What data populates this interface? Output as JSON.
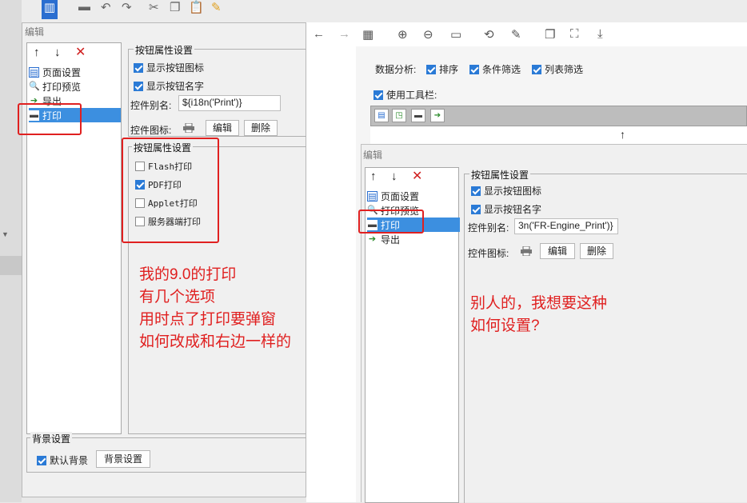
{
  "left_dialog": {
    "title": "编辑",
    "tree_items": [
      {
        "label": "页面设置",
        "icon": "page-setup-icon"
      },
      {
        "label": "打印预览",
        "icon": "print-preview-icon"
      },
      {
        "label": "导出",
        "icon": "export-icon"
      },
      {
        "label": "打印",
        "icon": "printer-icon",
        "selected": true
      }
    ],
    "button_props_legend": "按钮属性设置",
    "show_icon_label": "显示按钮图标",
    "show_name_label": "显示按钮名字",
    "alias_label": "控件别名:",
    "alias_value": "${i18n('Print')}",
    "icon_label": "控件图标:",
    "edit_button": "编辑",
    "delete_button": "删除",
    "print_options_legend": "按钮属性设置",
    "print_options": [
      {
        "label": "Flash打印",
        "checked": false
      },
      {
        "label": "PDF打印",
        "checked": true
      },
      {
        "label": "Applet打印",
        "checked": false
      },
      {
        "label": "服务器端打印",
        "checked": false
      }
    ],
    "bg_legend": "背景设置",
    "default_bg_label": "默认背景",
    "bg_settings_button": "背景设置"
  },
  "left_note": [
    "我的9.0的打印",
    "有几个选项",
    "用时点了打印要弹窗",
    "如何改成和右边一样的"
  ],
  "right_window": {
    "data_analysis_label": "数据分析:",
    "sort_label": "排序",
    "cond_filter_label": "条件筛选",
    "col_filter_label": "列表筛选",
    "use_toolbar_label": "使用工具栏:",
    "dialog_title": "编辑",
    "tree_items": [
      {
        "label": "页面设置",
        "icon": "page-setup-icon"
      },
      {
        "label": "打印预览",
        "icon": "print-preview-icon"
      },
      {
        "label": "打印",
        "icon": "printer-icon",
        "selected": true
      },
      {
        "label": "导出",
        "icon": "export-icon"
      }
    ],
    "button_props_legend": "按钮属性设置",
    "show_icon_label": "显示按钮图标",
    "show_name_label": "显示按钮名字",
    "alias_label": "控件别名:",
    "alias_value": "3n('FR-Engine_Print')}",
    "icon_label": "控件图标:",
    "edit_button": "编辑",
    "delete_button": "删除"
  },
  "right_note": [
    "别人的，我想要这种",
    "如何设置?"
  ],
  "colors": {
    "accent": "#2a7ad6",
    "selection": "#3c8fe0",
    "annotation": "#e02020"
  }
}
